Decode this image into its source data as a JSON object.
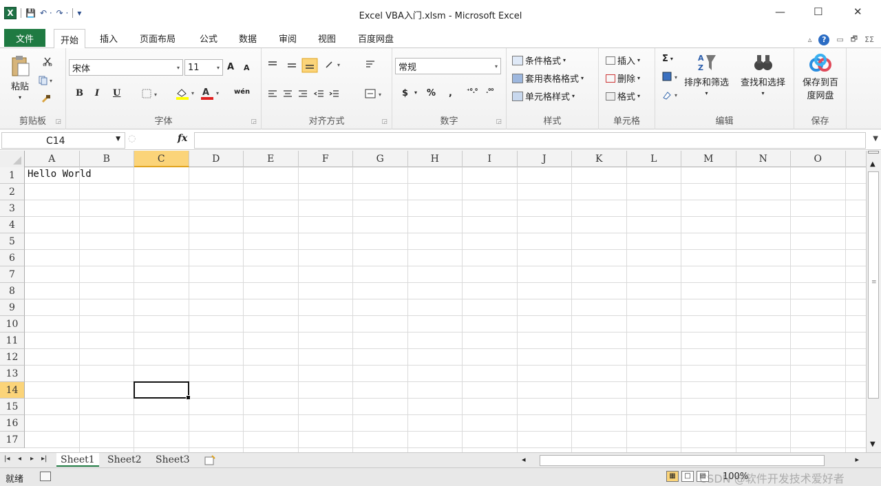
{
  "window": {
    "title": "Excel VBA入门.xlsm - Microsoft Excel",
    "logo": "X",
    "controls": {
      "minimize": "—",
      "maximize": "☐",
      "close": "✕"
    }
  },
  "qat": {
    "save": "💾",
    "undo": "↶ ·",
    "redo": "↷ ·",
    "customize": "▾"
  },
  "menu": {
    "tabs": [
      "文件",
      "开始",
      "插入",
      "页面布局",
      "公式",
      "数据",
      "审阅",
      "视图",
      "百度网盘"
    ],
    "active": "开始",
    "right": {
      "collapse": "▵",
      "help": "?",
      "min": "▭",
      "restore": "🗗",
      "close": "ΣΣ"
    }
  },
  "ribbon": {
    "clipboard": {
      "label": "剪贴板",
      "paste": "粘贴",
      "paste_dd": "▾"
    },
    "font": {
      "label": "字体",
      "name": "宋体",
      "size": "11",
      "grow": "A",
      "shrink": "A",
      "bold": "B",
      "italic": "I",
      "underline": "U",
      "phonetic": "wén"
    },
    "alignment": {
      "label": "对齐方式"
    },
    "number": {
      "label": "数字",
      "format": "常规",
      "currency": "$",
      "percent": "%",
      "comma": ",",
      "inc_dec": "⁺⁰.⁰",
      "dec_dec": ".⁰⁰"
    },
    "styles": {
      "label": "样式",
      "conditional": "条件格式",
      "table": "套用表格格式",
      "cell": "单元格样式"
    },
    "cells": {
      "label": "单元格",
      "insert": "插入",
      "delete": "删除",
      "format": "格式"
    },
    "editing": {
      "label": "编辑",
      "sum": "Σ",
      "sort": "排序和筛选",
      "find": "查找和选择"
    },
    "save": {
      "label": "保存",
      "button": "保存到百度网盘"
    }
  },
  "formula_bar": {
    "name_box": "C14",
    "fx": "fx",
    "value": ""
  },
  "grid": {
    "columns": [
      "A",
      "B",
      "C",
      "D",
      "E",
      "F",
      "G",
      "H",
      "I",
      "J",
      "K",
      "L",
      "M",
      "N",
      "O"
    ],
    "rows": [
      "1",
      "2",
      "3",
      "4",
      "5",
      "6",
      "7",
      "8",
      "9",
      "10",
      "11",
      "12",
      "13",
      "14",
      "15",
      "16",
      "17"
    ],
    "selected_column": "C",
    "selected_row": "14",
    "cells": {
      "A1": "Hello World"
    }
  },
  "sheets": {
    "tabs": [
      "Sheet1",
      "Sheet2",
      "Sheet3"
    ],
    "active": "Sheet1"
  },
  "status": {
    "text": "就绪",
    "zoom": "100%"
  },
  "watermark": "CSDN @软件开发技术爱好者",
  "colors": {
    "excel_green": "#1f7a42",
    "selection": "#fbd479"
  }
}
